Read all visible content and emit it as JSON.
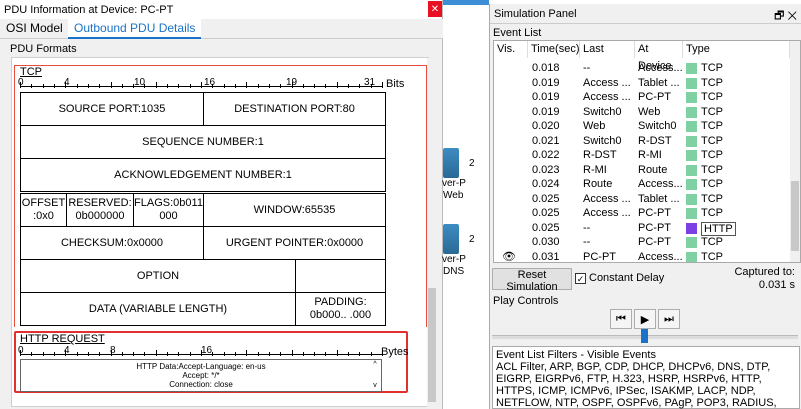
{
  "pdu_window": {
    "title": "PDU Information at Device: PC-PT",
    "close_glyph": "✕",
    "tabs": [
      {
        "label": "OSI Model"
      },
      {
        "label": "Outbound PDU Details"
      }
    ],
    "section_label": "PDU Formats"
  },
  "tcp": {
    "title": "TCP",
    "ruler": [
      "0",
      "4",
      "10",
      "16",
      "19",
      "31"
    ],
    "bits_label": "Bits",
    "source_port": "SOURCE PORT:1035",
    "dest_port": "DESTINATION PORT:80",
    "seq": "SEQUENCE NUMBER:1",
    "ack": "ACKNOWLEDGEMENT NUMBER:1",
    "offset": "OFFSET :0x0",
    "reserved": "RESERVED: 0b000000",
    "flags": "FLAGS:0b011 000",
    "window": "WINDOW:65535",
    "checksum": "CHECKSUM:0x0000",
    "urgent": "URGENT POINTER:0x0000",
    "option": "OPTION",
    "data": "DATA (VARIABLE LENGTH)",
    "padding": "PADDING: 0b000.. .000"
  },
  "http": {
    "title": "HTTP REQUEST",
    "ruler": [
      "0",
      "4",
      "8",
      "16"
    ],
    "bits_label": "Bytes",
    "line1": "HTTP Data:Accept-Language: en-us",
    "line2": "Accept: */*",
    "line3": "Connection: close",
    "scroll_up": "^",
    "scroll_down": "v"
  },
  "topology": {
    "label1": "ver-P",
    "label2": "Web",
    "label3": "ver-P",
    "label4": "DNS",
    "digit1": "2",
    "digit2": "2"
  },
  "sim_panel": {
    "title": "Simulation Panel",
    "window_icons": "🗗 ✕",
    "event_list_label": "Event List",
    "columns": [
      "Vis.",
      "Time(sec)",
      "Last Device",
      "At Device",
      "Type"
    ],
    "rows": [
      {
        "vis": "",
        "time": "0.018",
        "last": "--",
        "at": "Access...",
        "type": "TCP",
        "color": "#7fd1a4"
      },
      {
        "vis": "",
        "time": "0.019",
        "last": "Access ...",
        "at": "Tablet ...",
        "type": "TCP",
        "color": "#7fd1a4"
      },
      {
        "vis": "",
        "time": "0.019",
        "last": "Access ...",
        "at": "PC-PT",
        "type": "TCP",
        "color": "#7fd1a4"
      },
      {
        "vis": "",
        "time": "0.019",
        "last": "Switch0",
        "at": "Web",
        "type": "TCP",
        "color": "#7fd1a4"
      },
      {
        "vis": "",
        "time": "0.020",
        "last": "Web",
        "at": "Switch0",
        "type": "TCP",
        "color": "#7fd1a4"
      },
      {
        "vis": "",
        "time": "0.021",
        "last": "Switch0",
        "at": "R-DST",
        "type": "TCP",
        "color": "#7fd1a4"
      },
      {
        "vis": "",
        "time": "0.022",
        "last": "R-DST",
        "at": "R-MI",
        "type": "TCP",
        "color": "#7fd1a4"
      },
      {
        "vis": "",
        "time": "0.023",
        "last": "R-MI",
        "at": "Route",
        "type": "TCP",
        "color": "#7fd1a4"
      },
      {
        "vis": "",
        "time": "0.024",
        "last": "Route",
        "at": "Access...",
        "type": "TCP",
        "color": "#7fd1a4"
      },
      {
        "vis": "",
        "time": "0.025",
        "last": "Access ...",
        "at": "Tablet ...",
        "type": "TCP",
        "color": "#7fd1a4"
      },
      {
        "vis": "",
        "time": "0.025",
        "last": "Access ...",
        "at": "PC-PT",
        "type": "TCP",
        "color": "#7fd1a4"
      },
      {
        "vis": "",
        "time": "0.025",
        "last": "--",
        "at": "PC-PT",
        "type": "HTTP",
        "color": "#7b3fe4"
      },
      {
        "vis": "",
        "time": "0.030",
        "last": "--",
        "at": "PC-PT",
        "type": "TCP",
        "color": "#7fd1a4"
      },
      {
        "vis": "👁",
        "time": "0.031",
        "last": "PC-PT",
        "at": "Access...",
        "type": "TCP",
        "color": "#7fd1a4"
      }
    ],
    "reset_label": "Reset Simulation",
    "constant_delay_label": "Constant Delay",
    "check_glyph": "✓",
    "captured_label": "Captured to:",
    "captured_value": "0.031 s",
    "play_controls_label": "Play Controls",
    "play_back": "⏮",
    "play_play": "▶",
    "play_forward": "⏭",
    "filters_title": "Event List Filters - Visible Events",
    "filters_text": "ACL Filter, ARP, BGP, CDP, DHCP, DHCPv6, DNS, DTP, EIGRP, EIGRPv6, FTP, H.323, HSRP, HSRPv6, HTTP, HTTPS, ICMP, ICMPv6, IPSec, ISAKMP, LACP, NDP, NETFLOW, NTP, OSPF, OSPFv6, PAgP, POP3, RADIUS, RIP, RIPng, RTP, SCCP, SMTP,"
  }
}
